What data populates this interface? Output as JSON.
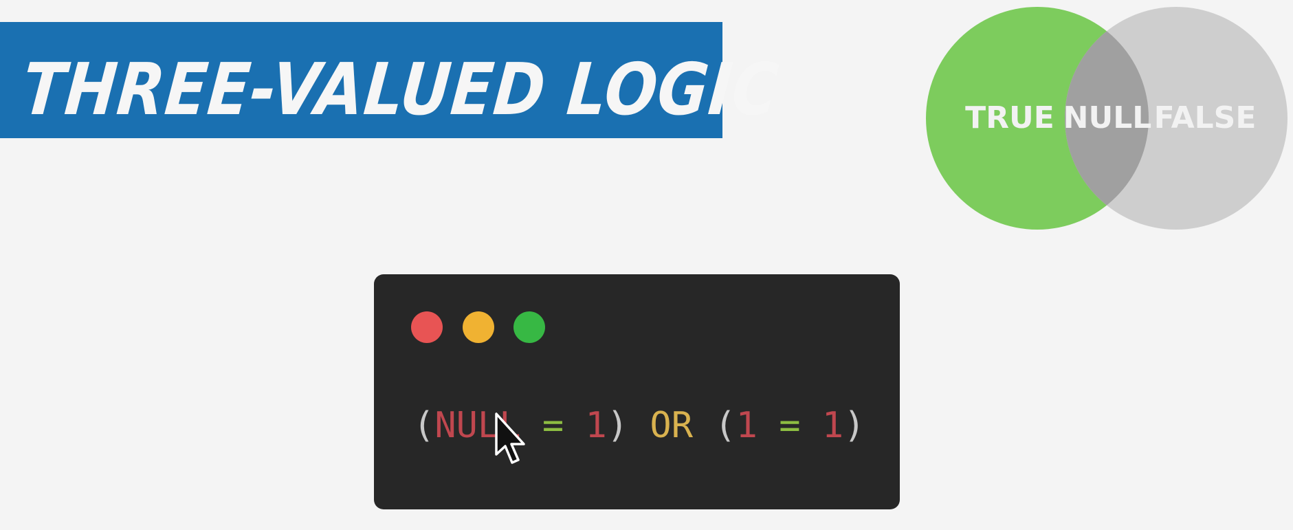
{
  "title": "THREE-VALUED LOGIC",
  "venn": {
    "labels": {
      "left": "TRUE",
      "middle": "NULL",
      "right": "FALSE"
    },
    "colors": {
      "left": "#7dcc5d",
      "right": "#cecece",
      "overlap": "#a0a0a0",
      "text": "#f2f2f2"
    }
  },
  "terminal": {
    "window_dots": {
      "red": "#e85454",
      "yellow": "#f0b232",
      "green": "#37b844"
    },
    "code_tokens": {
      "open_paren_1": "(",
      "null_kw": "NULL",
      "eq_1": " = ",
      "num_1": "1",
      "close_paren_1": ")",
      "or_kw": " OR ",
      "open_paren_2": "(",
      "num_2": "1",
      "eq_2": " = ",
      "num_3": "1",
      "close_paren_2": ")"
    }
  },
  "colors": {
    "background": "#f4f4f4",
    "banner": "#1a70b1",
    "terminal_bg": "#272727"
  },
  "icons": {
    "cursor": "mouse-pointer-icon"
  }
}
